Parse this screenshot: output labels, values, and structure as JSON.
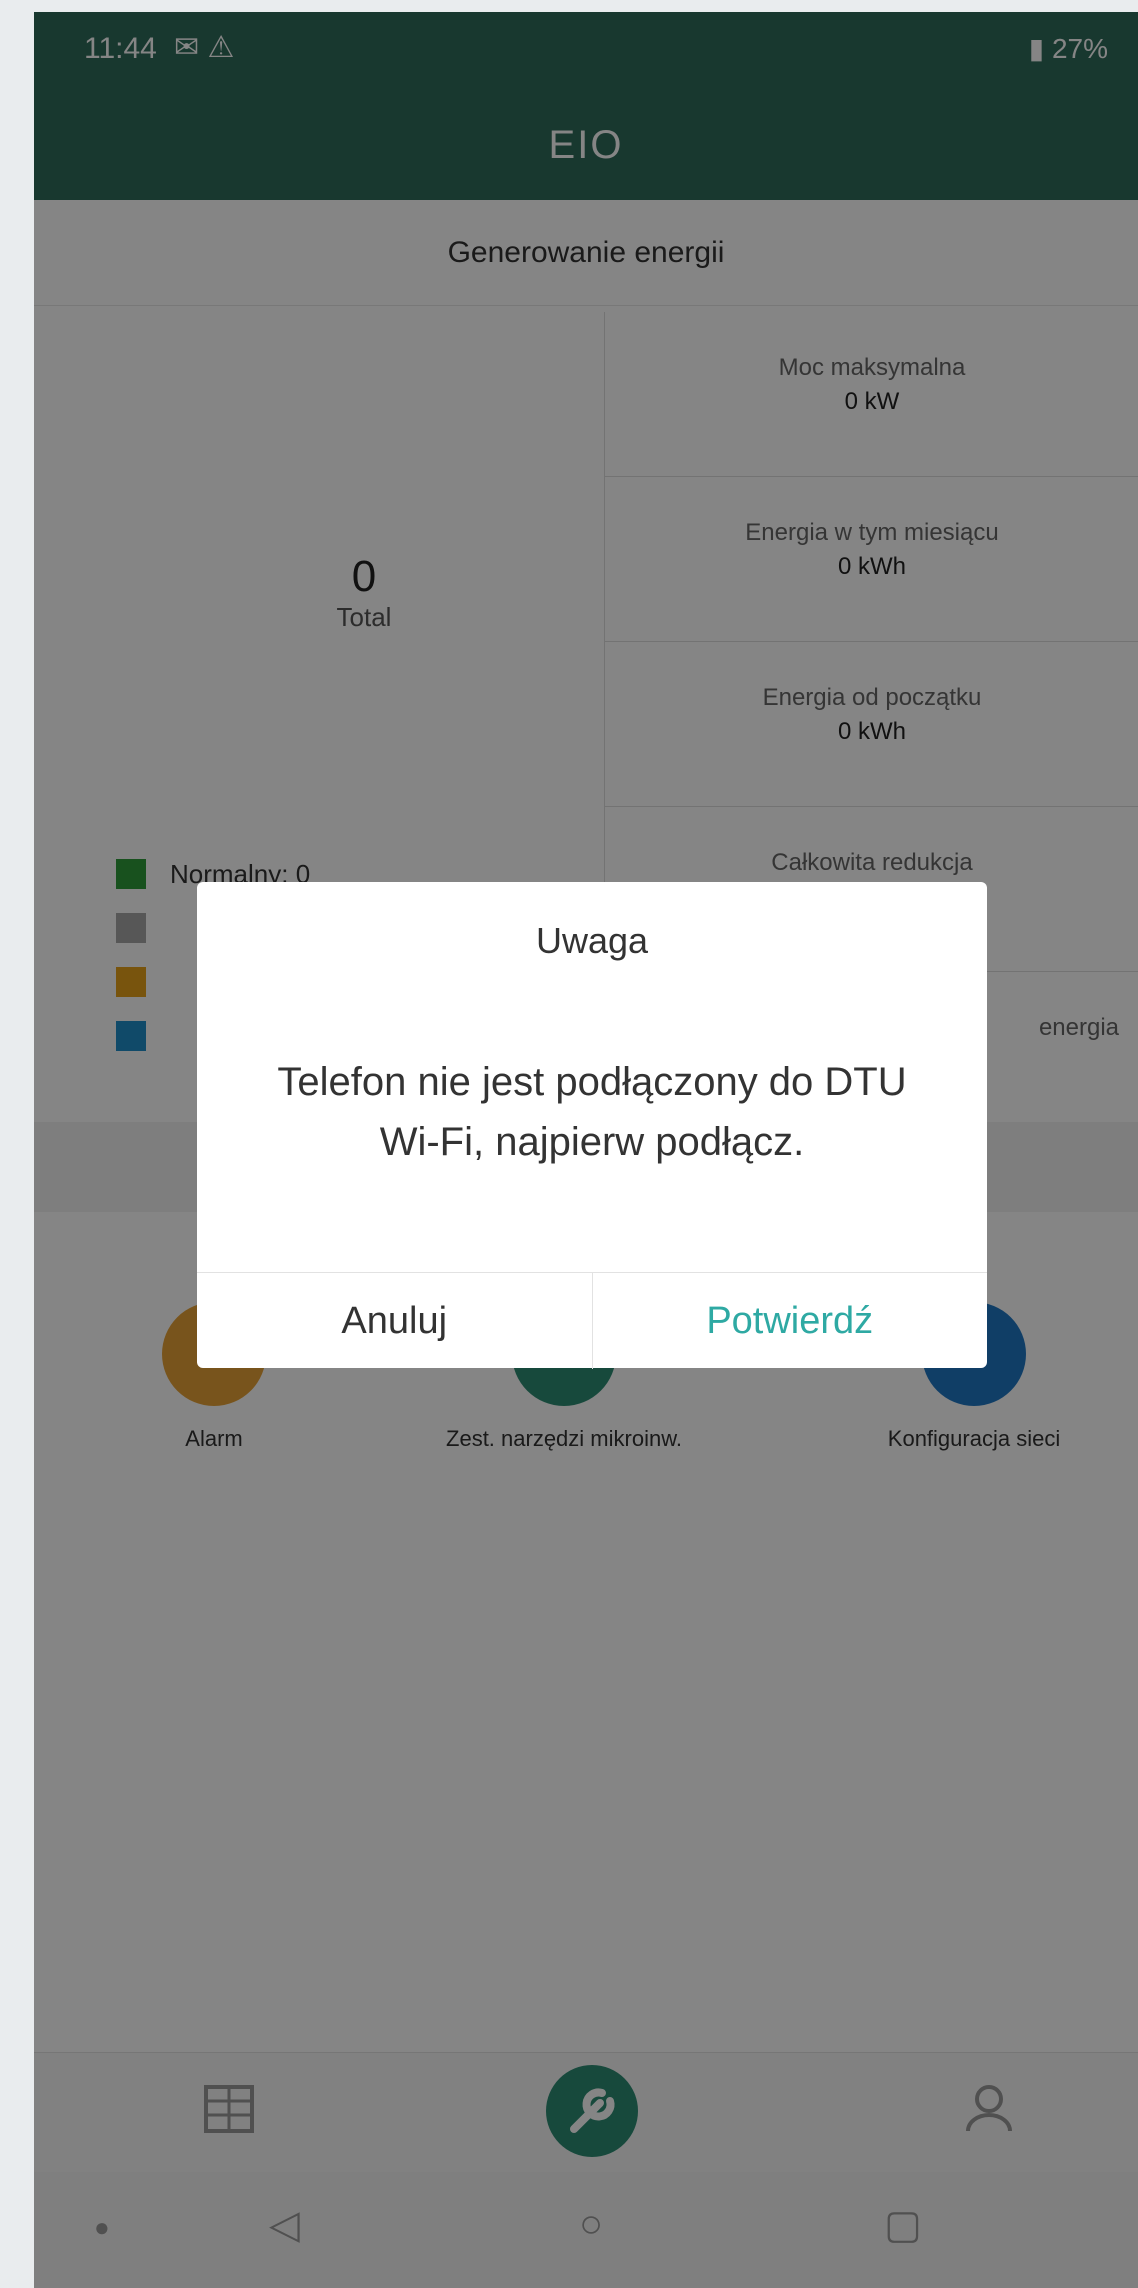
{
  "status": {
    "time": "11:44",
    "battery": "27%"
  },
  "app": {
    "title": "EIO",
    "section_title": "Generowanie energii"
  },
  "summary": {
    "total_value": "0",
    "total_label": "Total"
  },
  "stats": [
    {
      "label": "Moc maksymalna",
      "value": "0 kW"
    },
    {
      "label": "Energia w tym miesiącu",
      "value": "0 kWh"
    },
    {
      "label": "Energia od początku",
      "value": "0 kWh"
    },
    {
      "label": "Całkowita redukcja",
      "value": ""
    },
    {
      "label": "energia",
      "value": ""
    }
  ],
  "legend": [
    {
      "label": "Normalny: 0",
      "color": "#2e9b3a"
    },
    {
      "label": "",
      "color": "#a8a8a8"
    },
    {
      "label": "",
      "color": "#e6a21a"
    },
    {
      "label": "",
      "color": "#1f8ec9"
    }
  ],
  "tiles": [
    {
      "label": "Alarm",
      "color": "#e6a237"
    },
    {
      "label": "Zest. narzędzi mikroinw.",
      "color": "#2d8c74"
    },
    {
      "label": "Konfiguracja sieci",
      "color": "#1f77c4"
    }
  ],
  "dialog": {
    "title": "Uwaga",
    "message": "Telefon nie jest podłączony do DTU Wi-Fi, najpierw podłącz.",
    "cancel": "Anuluj",
    "confirm": "Potwierdź"
  },
  "bottom_nav": [
    {
      "icon": "building-icon"
    },
    {
      "icon": "wrench-icon"
    },
    {
      "icon": "user-icon"
    }
  ]
}
